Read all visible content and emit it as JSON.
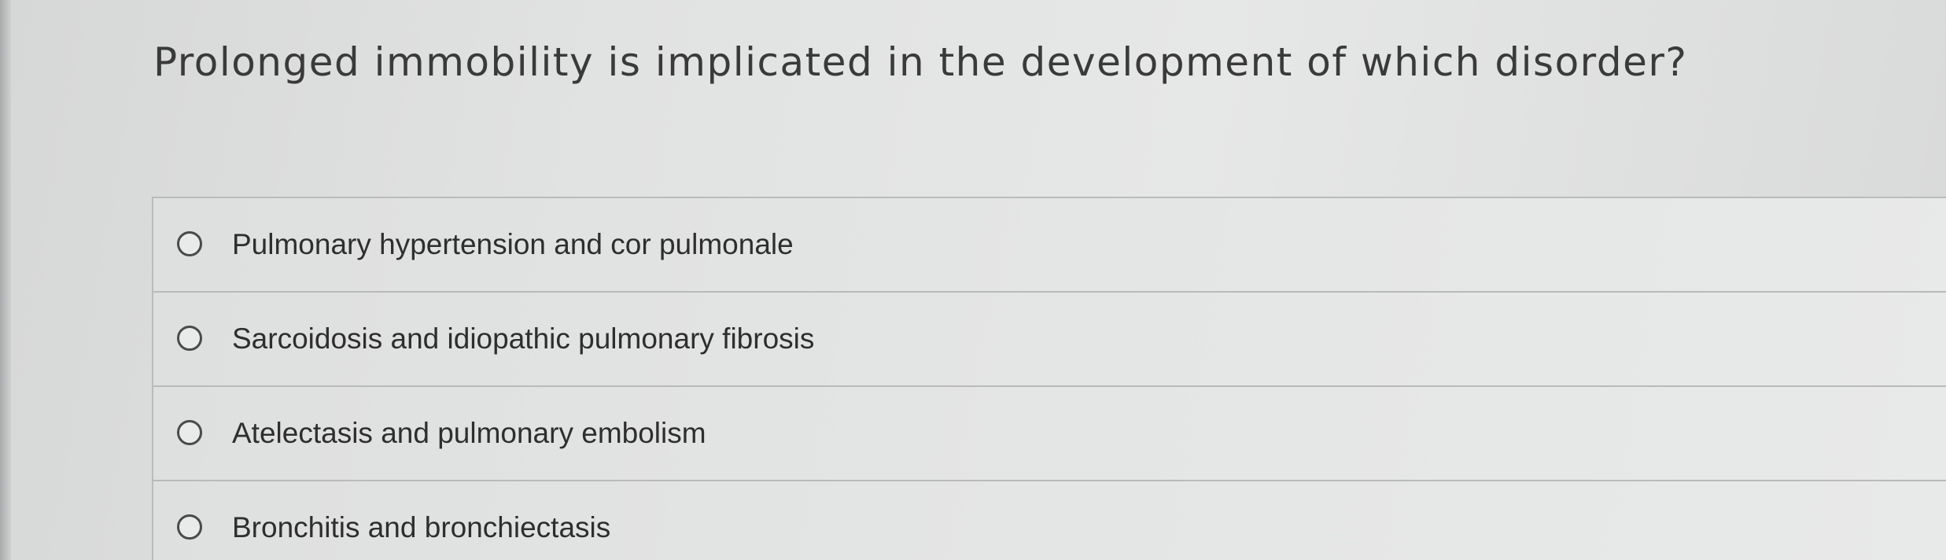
{
  "question": {
    "text": "Prolonged immobility is implicated in the development of which disorder?"
  },
  "options": [
    {
      "label": "Pulmonary hypertension and cor pulmonale",
      "selected": false
    },
    {
      "label": "Sarcoidosis and idiopathic pulmonary fibrosis",
      "selected": false
    },
    {
      "label": "Atelectasis and pulmonary embolism",
      "selected": false
    },
    {
      "label": "Bronchitis and bronchiectasis",
      "selected": false
    }
  ],
  "colors": {
    "text": "#2e2e2e",
    "border": "#b8babb",
    "radio_border": "#4a4a4a"
  }
}
